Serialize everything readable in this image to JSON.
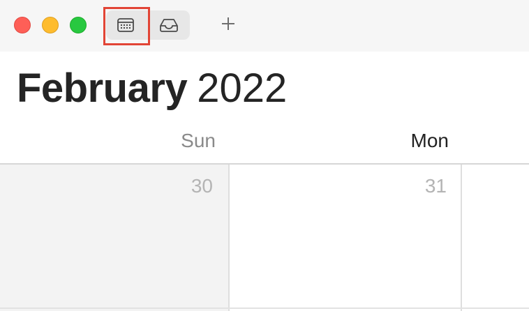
{
  "window": {
    "controls": [
      "close",
      "minimize",
      "zoom"
    ],
    "colors": {
      "close": "#fe5f57",
      "minimize": "#febc2e",
      "zoom": "#28c840",
      "highlight": "#e24536",
      "weekend_cell": "#f3f3f3"
    }
  },
  "toolbar": {
    "calendar_view_icon": "calendar-grid-icon",
    "inbox_icon": "inbox-tray-icon",
    "add_label": "+"
  },
  "header": {
    "month": "February",
    "year": "2022"
  },
  "week": {
    "day_names": [
      "Sun",
      "Mon"
    ],
    "dates": [
      "30",
      "31"
    ]
  }
}
